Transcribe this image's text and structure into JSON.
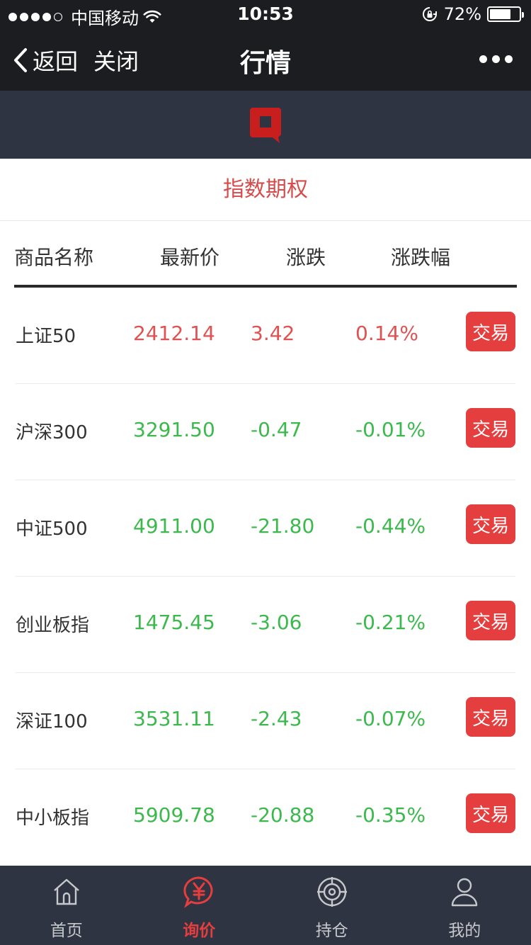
{
  "status_bar": {
    "carrier": "中国移动",
    "time": "10:53",
    "battery_pct": "72%",
    "battery_level": 0.72
  },
  "nav": {
    "back_label": "返回",
    "close_label": "关闭",
    "title": "行情"
  },
  "section_title": "指数期权",
  "table": {
    "headers": [
      "商品名称",
      "最新价",
      "涨跌",
      "涨跌幅"
    ],
    "trade_label": "交易",
    "rows": [
      {
        "name": "上证50",
        "price": "2412.14",
        "change": "3.42",
        "pct": "0.14%",
        "dir": "up"
      },
      {
        "name": "沪深300",
        "price": "3291.50",
        "change": "-0.47",
        "pct": "-0.01%",
        "dir": "down"
      },
      {
        "name": "中证500",
        "price": "4911.00",
        "change": "-21.80",
        "pct": "-0.44%",
        "dir": "down"
      },
      {
        "name": "创业板指",
        "price": "1475.45",
        "change": "-3.06",
        "pct": "-0.21%",
        "dir": "down"
      },
      {
        "name": "深证100",
        "price": "3531.11",
        "change": "-2.43",
        "pct": "-0.07%",
        "dir": "down"
      },
      {
        "name": "中小板指",
        "price": "5909.78",
        "change": "-20.88",
        "pct": "-0.35%",
        "dir": "down"
      }
    ]
  },
  "tabs": [
    {
      "label": "首页",
      "icon": "home-icon",
      "active": false
    },
    {
      "label": "询价",
      "icon": "yuan-chat-icon",
      "active": true
    },
    {
      "label": "持仓",
      "icon": "target-icon",
      "active": false
    },
    {
      "label": "我的",
      "icon": "user-icon",
      "active": false
    }
  ],
  "colors": {
    "up": "#e05252",
    "down": "#3cb94d",
    "accent": "#e53e3e",
    "nav_bg": "#1c1d21",
    "brand_bg": "#2f3442"
  }
}
